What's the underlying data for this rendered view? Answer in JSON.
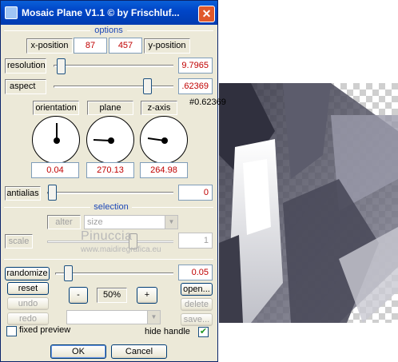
{
  "window": {
    "title": "Mosaic Plane V1.1 © by Frischluf..."
  },
  "options": {
    "title": "options",
    "x_position": {
      "label": "x-position",
      "value": "87"
    },
    "y_position": {
      "label": "y-position",
      "value": "457"
    },
    "resolution": {
      "label": "resolution",
      "value": "9.7965"
    },
    "aspect": {
      "label": "aspect",
      "value": ".62369",
      "tooltip": "#0.62369"
    },
    "dials": [
      {
        "label": "orientation",
        "value": "0.04"
      },
      {
        "label": "plane",
        "value": "270.13"
      },
      {
        "label": "z-axis",
        "value": "264.98"
      }
    ],
    "antialias": {
      "label": "antialias",
      "value": "0"
    }
  },
  "selection": {
    "title": "selection",
    "alter_label": "alter",
    "size_select": "size",
    "scale": {
      "label": "scale",
      "value": "1"
    }
  },
  "watermark": {
    "line1": "Pinuccia",
    "line2": "www.maidiregrafica.eu"
  },
  "controls": {
    "randomize": {
      "label": "randomize",
      "value": "0.05"
    },
    "reset_label": "reset",
    "undo_label": "undo",
    "redo_label": "redo",
    "zoom_out": "-",
    "zoom_value": "50%",
    "zoom_in": "+",
    "open_label": "open...",
    "delete_label": "delete",
    "save_label": "save...",
    "fixed_preview": {
      "label": "fixed preview",
      "checked": false
    },
    "hide_handle": {
      "label": "hide handle",
      "checked": true
    },
    "ok_label": "OK",
    "cancel_label": "Cancel"
  },
  "colors": {
    "title_bar": "#0054e3",
    "value_text": "#c00000",
    "section_title": "#1c47b7"
  }
}
